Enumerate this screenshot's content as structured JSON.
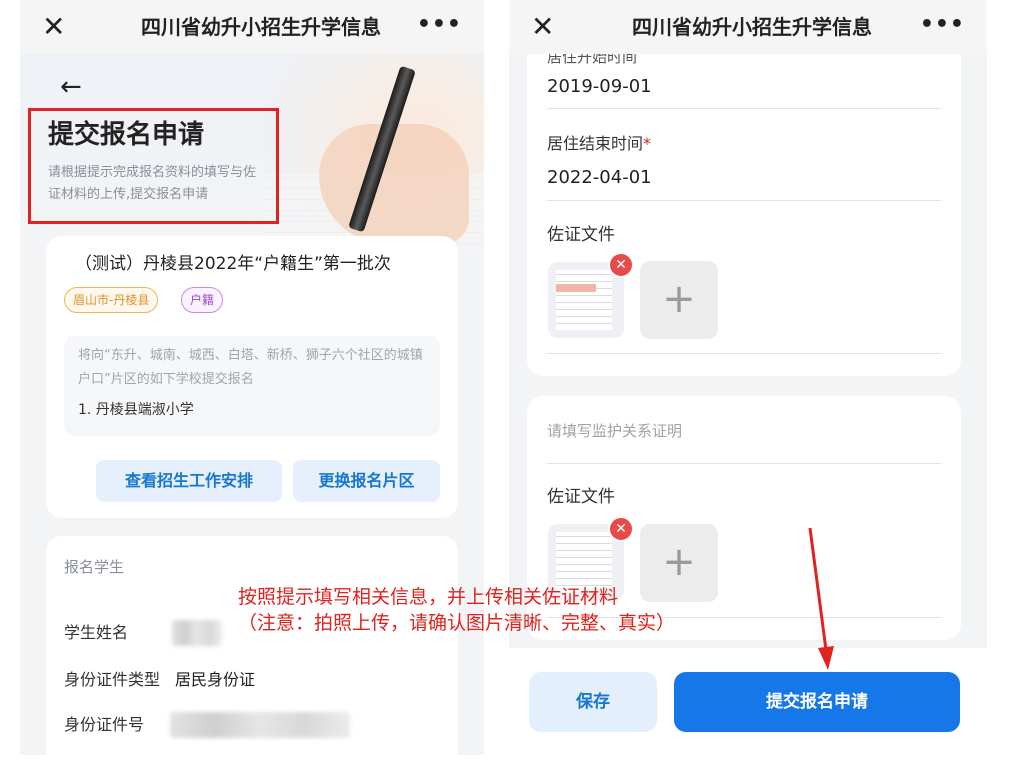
{
  "left_screen": {
    "nav": {
      "close_icon": "close-icon",
      "title": "四川省幼升小招生升学信息",
      "more_icon": "more-icon"
    },
    "back_icon": "back-arrow-icon",
    "hero": {
      "title": "提交报名申请",
      "subtitle": "请根据提示完成报名资料的填写与佐证材料的上传,提交报名申请"
    },
    "batch": {
      "title": "（测试）丹棱县2022年“户籍生”第一批次",
      "tags": [
        "眉山市-丹棱县",
        "户籍"
      ],
      "notice": "将向“东升、城南、城西、白塔、新桥、狮子六个社区的城镇户口”片区的如下学校提交报名",
      "school": "1. 丹棱县端淑小学",
      "buttons": [
        "查看招生工作安排",
        "更换报名片区"
      ]
    },
    "student": {
      "section_label": "报名学生",
      "name_label": "学生姓名",
      "id_type_label": "身份证件类型",
      "id_type_value": "居民身份证",
      "id_number_label": "身份证件号"
    }
  },
  "right_screen": {
    "nav": {
      "close_icon": "close-icon",
      "title": "四川省幼升小招生升学信息",
      "more_icon": "more-icon"
    },
    "residence_start_label": "居住开始时间",
    "residence_start_value": "2019-09-01",
    "residence_end_label": "居住结束时间",
    "required_mark": "*",
    "residence_end_value": "2022-04-01",
    "proof_label_1": "佐证文件",
    "guardian_placeholder": "请填写监护关系证明",
    "proof_label_2": "佐证文件",
    "add_glyph": "+",
    "delete_glyph": "✕",
    "save_label": "保存",
    "submit_label": "提交报名申请"
  },
  "annotation": {
    "line1": "按照提示填写相关信息，并上传相关佐证材料",
    "line2": "（注意：拍照上传，请确认图片清晰、完整、真实）",
    "color": "#e0231f"
  },
  "colors": {
    "accent": "#1677e8",
    "annotation": "#e0231f",
    "tag_region": "#e0912a",
    "tag_type": "#9b49d8"
  }
}
